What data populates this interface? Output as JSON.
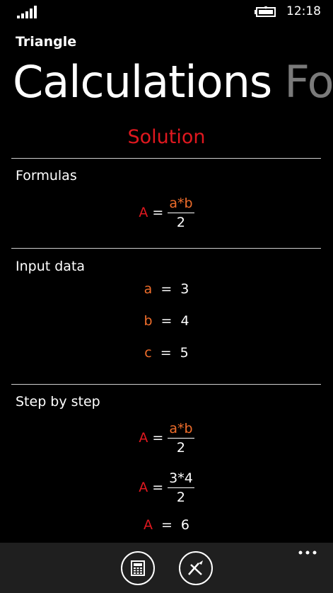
{
  "status": {
    "time": "12:18"
  },
  "app": {
    "title": "Triangle"
  },
  "pivot": {
    "tabs": [
      {
        "label": "Calculations"
      },
      {
        "label": "Formulas"
      }
    ]
  },
  "solution": {
    "title": "Solution"
  },
  "sections": {
    "formulas": {
      "label": "Formulas",
      "lhs": "A",
      "op": "=",
      "numerator": "a*b",
      "denominator": "2"
    },
    "input": {
      "label": "Input data",
      "rows": [
        {
          "var": "a",
          "op": "=",
          "value": "3"
        },
        {
          "var": "b",
          "op": "=",
          "value": "4"
        },
        {
          "var": "c",
          "op": "=",
          "value": "5"
        }
      ]
    },
    "steps": {
      "label": "Step by step",
      "step1": {
        "lhs": "A",
        "op": "=",
        "numerator": "a*b",
        "denominator": "2"
      },
      "step2": {
        "lhs": "A",
        "op": "=",
        "numerator": "3*4",
        "denominator": "2"
      },
      "result": {
        "lhs": "A",
        "op": "=",
        "value": "6"
      }
    }
  },
  "appbar": {
    "buttons": [
      {
        "icon": "calculator-icon"
      },
      {
        "icon": "clear-icon"
      }
    ],
    "more": "more-dots-icon"
  },
  "colors": {
    "accent": "#e0181f",
    "variable": "#ef6d2b",
    "background": "#000000",
    "appbar": "#1f1f1f"
  }
}
